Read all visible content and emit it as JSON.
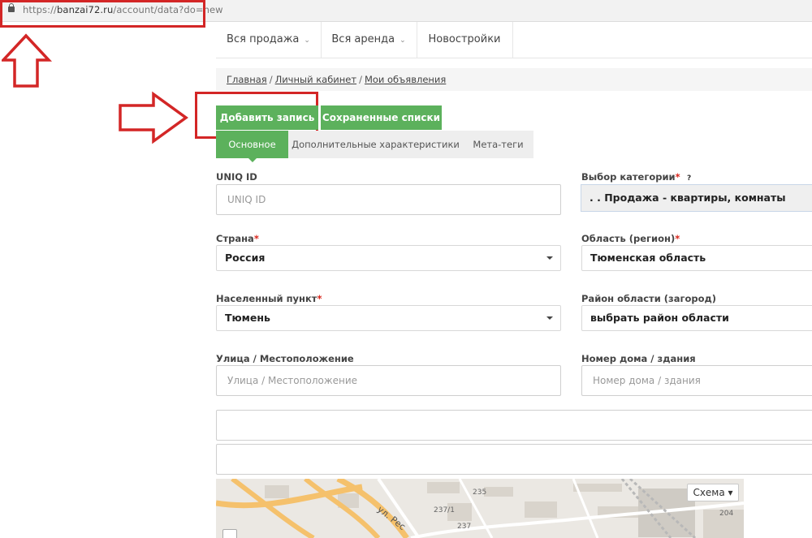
{
  "browser": {
    "url_prefix": "https://",
    "url_host": "banzai72.ru",
    "url_path": "/account/data?do=new"
  },
  "nav": {
    "items": [
      {
        "label": "Вся продажа",
        "has_caret": true
      },
      {
        "label": "Вся аренда",
        "has_caret": true
      },
      {
        "label": "Новостройки",
        "has_caret": false
      }
    ],
    "caret": "⌄"
  },
  "breadcrumbs": {
    "items": [
      "Главная",
      "Личный кабинет",
      "Мои объявления"
    ],
    "separator": "/"
  },
  "actions": {
    "add_record": "Добавить запись",
    "saved_lists": "Сохраненные списки"
  },
  "tabs": [
    {
      "label": "Основное",
      "active": true
    },
    {
      "label": "Дополнительные характеристики",
      "active": false
    },
    {
      "label": "Мета-теги",
      "active": false
    }
  ],
  "form": {
    "uniq_id": {
      "label": "UNIQ ID",
      "placeholder": "UNIQ ID"
    },
    "category": {
      "label": "Выбор категории",
      "required_mark": "*",
      "help": "?",
      "value": ". . Продажа - квартиры, комнаты"
    },
    "country": {
      "label": "Страна",
      "required_mark": "*",
      "value": "Россия"
    },
    "region": {
      "label": "Область (регион)",
      "required_mark": "*",
      "value": "Тюменская область"
    },
    "locality": {
      "label": "Населенный пункт",
      "required_mark": "*",
      "value": "Тюмень"
    },
    "district": {
      "label": "Район области (загород)",
      "value": "выбрать район области"
    },
    "street": {
      "label": "Улица / Местоположение",
      "placeholder": "Улица / Местоположение"
    },
    "house": {
      "label": "Номер дома / здания",
      "placeholder": "Номер дома / здания"
    }
  },
  "map": {
    "type_button": "Схема ▾",
    "labels": [
      "235",
      "237/1",
      "237",
      "204",
      "ул. Рес"
    ]
  },
  "colors": {
    "accent_green": "#5cb15c",
    "annotation_red": "#d32626",
    "required_red": "#d9261c"
  }
}
